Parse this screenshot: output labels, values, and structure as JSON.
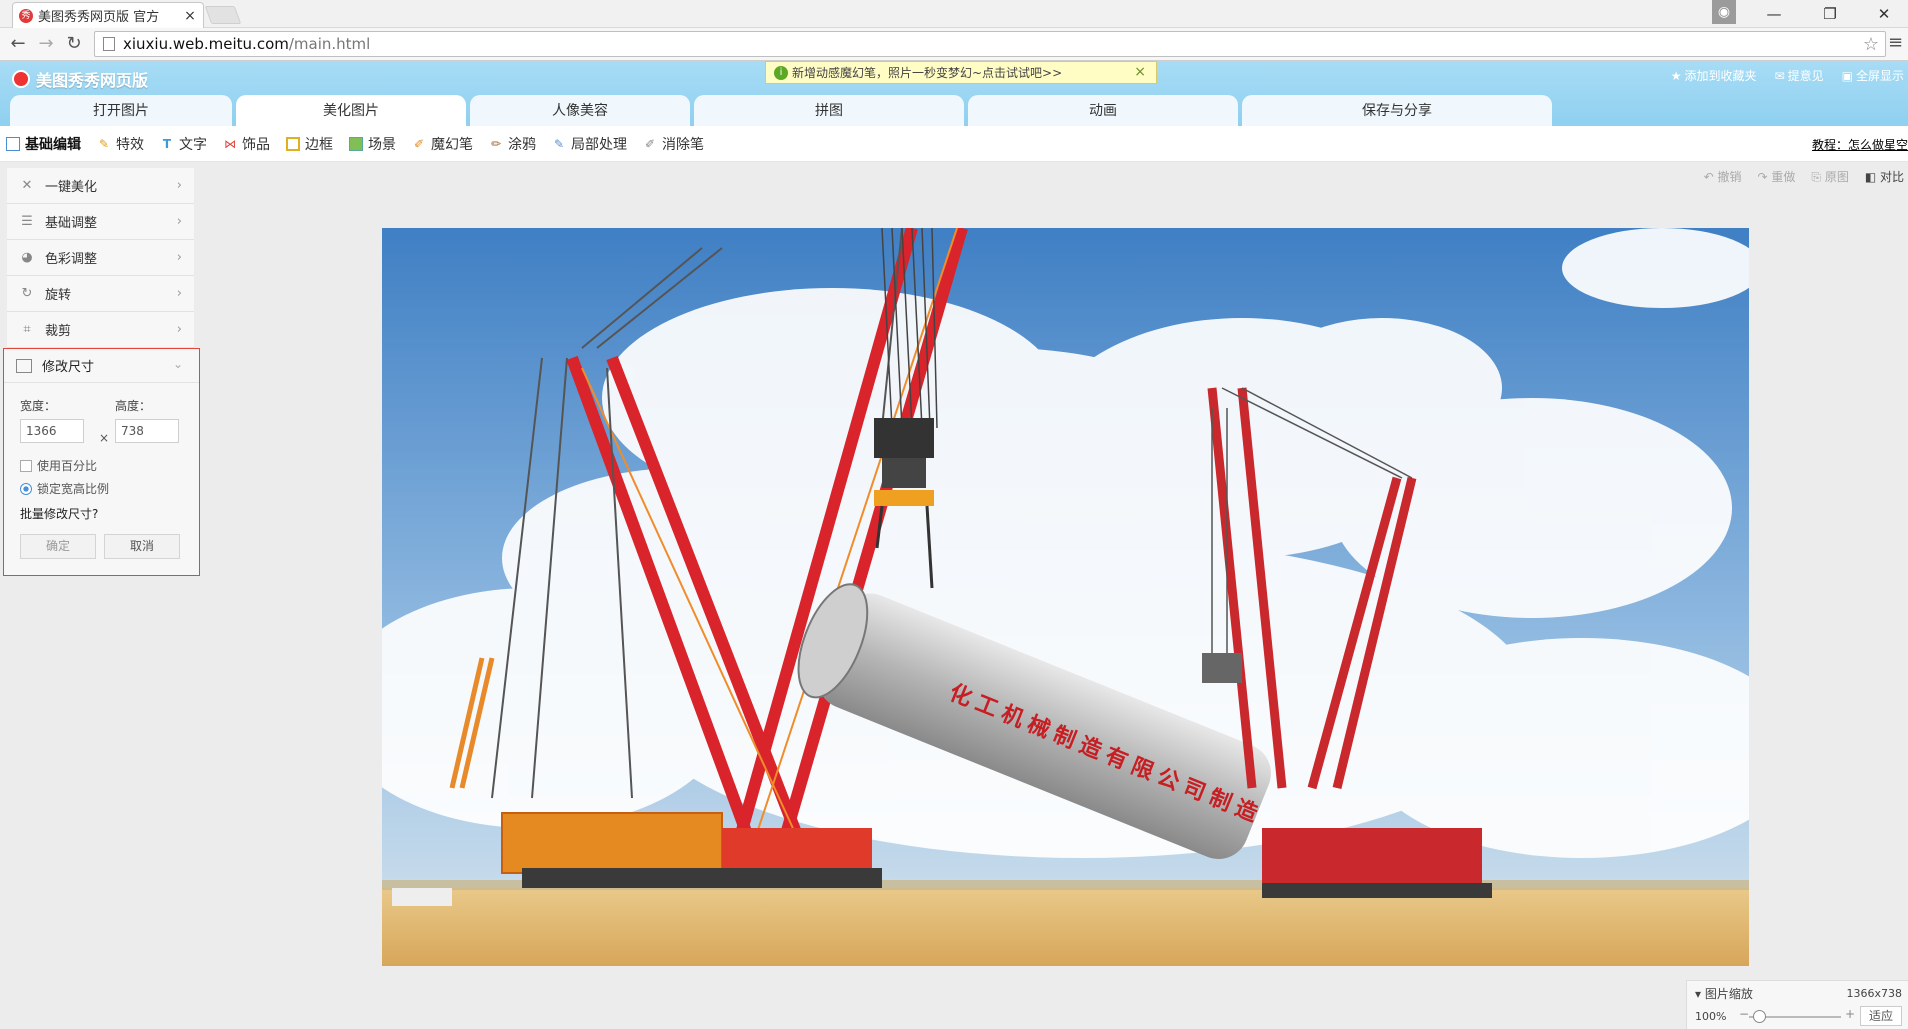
{
  "browser": {
    "tab_title": "美图秀秀网页版 官方",
    "url_domain": "xiuxiu.web.meitu.com",
    "url_path": "/main.html"
  },
  "app": {
    "logo_text": "美图秀秀网页版",
    "notice": "新增动感魔幻笔，照片一秒变梦幻~点击试试吧>>",
    "top_links": [
      "添加到收藏夹",
      "提意见",
      "全屏显示"
    ],
    "tabs": [
      "打开图片",
      "美化图片",
      "人像美容",
      "拼图",
      "动画",
      "保存与分享"
    ],
    "active_tab": "美化图片"
  },
  "toolbar": {
    "items": [
      {
        "label": "基础编辑",
        "icon": "edit-icon"
      },
      {
        "label": "特效",
        "icon": "magic-wand-icon"
      },
      {
        "label": "文字",
        "icon": "text-icon"
      },
      {
        "label": "饰品",
        "icon": "bow-icon"
      },
      {
        "label": "边框",
        "icon": "frame-icon"
      },
      {
        "label": "场景",
        "icon": "scene-icon"
      },
      {
        "label": "魔幻笔",
        "icon": "magic-pen-icon"
      },
      {
        "label": "涂鸦",
        "icon": "doodle-icon"
      },
      {
        "label": "局部处理",
        "icon": "brush-icon"
      },
      {
        "label": "消除笔",
        "icon": "eraser-icon"
      }
    ],
    "tutorial": "教程：怎么做星空"
  },
  "sidebar": {
    "items": [
      {
        "label": "一键美化",
        "icon": "wand-icon"
      },
      {
        "label": "基础调整",
        "icon": "sliders-icon"
      },
      {
        "label": "色彩调整",
        "icon": "palette-icon"
      },
      {
        "label": "旋转",
        "icon": "rotate-icon"
      },
      {
        "label": "裁剪",
        "icon": "crop-icon"
      }
    ],
    "resize": {
      "title": "修改尺寸",
      "width_label": "宽度：",
      "height_label": "高度：",
      "width_value": "1366",
      "height_value": "738",
      "times": "×",
      "use_percent": "使用百分比",
      "lock_ratio": "锁定宽高比例",
      "batch": "批量修改尺寸?",
      "confirm": "确定",
      "cancel": "取消"
    }
  },
  "history": {
    "undo": "撤销",
    "redo": "重做",
    "original": "原图",
    "compare": "对比"
  },
  "zoom": {
    "title": "图片缩放",
    "dimensions": "1366x738",
    "percent": "100%",
    "fit": "适应"
  },
  "photo_tank_text": "化工机械制造有限公司制造",
  "colors": {
    "header_blue": "#96d3f1",
    "crane_red": "#d8242a",
    "highlight_border": "#e2453b"
  }
}
